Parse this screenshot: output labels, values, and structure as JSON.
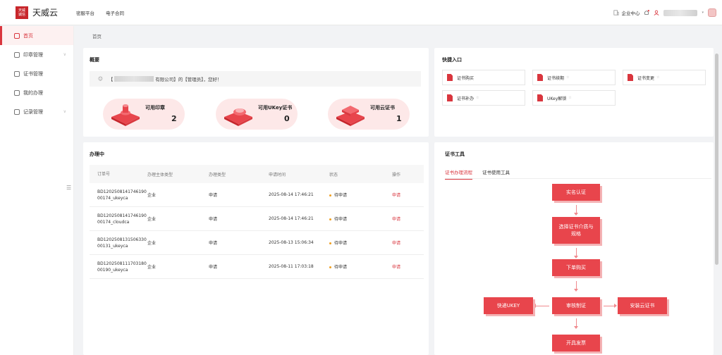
{
  "header": {
    "logo_text": "天威\n诚信",
    "brand": "天威云",
    "nav": [
      "密服平台",
      "电子合同"
    ],
    "enterprise_center": "企业中心"
  },
  "sidebar": {
    "items": [
      {
        "label": "首页",
        "icon": "home-icon",
        "active": true
      },
      {
        "label": "印章管理",
        "icon": "seal-icon",
        "has_children": true
      },
      {
        "label": "证书管理",
        "icon": "certificate-icon"
      },
      {
        "label": "我的办理",
        "icon": "task-icon"
      },
      {
        "label": "记录管理",
        "icon": "record-icon",
        "has_children": true
      }
    ]
  },
  "breadcrumb": "首页",
  "overview": {
    "title": "概要",
    "greeting_prefix": "【",
    "greeting_company_suffix": "有限公司】的【管理员】，您好！",
    "stats": [
      {
        "label": "可用印章",
        "value": "2"
      },
      {
        "label": "可用UKey证书",
        "value": "0"
      },
      {
        "label": "可用云证书",
        "value": "1"
      }
    ]
  },
  "quick_entry": {
    "title": "快捷入口",
    "items": [
      {
        "label": "证书购买",
        "starred": false
      },
      {
        "label": "证书续期",
        "starred": true
      },
      {
        "label": "证书变更",
        "starred": true
      },
      {
        "label": "证书补办",
        "starred": true
      },
      {
        "label": "UKey解锁",
        "starred": true
      }
    ],
    "star_glyph": "☆"
  },
  "processing": {
    "title": "办理中",
    "columns": [
      "订单号",
      "办理主体类型",
      "办理类型",
      "申请时间",
      "状态",
      "操作"
    ],
    "rows": [
      {
        "order_no_1": "BD1202508141746190",
        "order_no_2": "00174_ukeyca",
        "subject": "企业",
        "type": "申请",
        "time": "2025-08-14 17:46:21",
        "status": "待申请",
        "action": "申请"
      },
      {
        "order_no_1": "BD1202508141746190",
        "order_no_2": "00174_cloudca",
        "subject": "企业",
        "type": "申请",
        "time": "2025-08-14 17:46:21",
        "status": "待申请",
        "action": "申请"
      },
      {
        "order_no_1": "BD1202508131506330",
        "order_no_2": "00131_ukeyca",
        "subject": "企业",
        "type": "申请",
        "time": "2025-08-13 15:06:34",
        "status": "待申请",
        "action": "申请"
      },
      {
        "order_no_1": "BD1202508111703180",
        "order_no_2": "00190_ukeyca",
        "subject": "企业",
        "type": "申请",
        "time": "2025-08-11 17:03:18",
        "status": "待申请",
        "action": "申请"
      }
    ]
  },
  "cert_tools": {
    "title": "证书工具",
    "tabs": [
      "证书办理流程",
      "证书使用工具"
    ],
    "flow": {
      "step1": "实名认证",
      "step2": "选择证书介质与规格",
      "step3": "下单购买",
      "step4": "审核制证",
      "left": "快递UKEY",
      "right": "安装云证书",
      "step5": "开具发票"
    }
  },
  "colors": {
    "accent": "#d9363e",
    "flow_box": "#e8454c",
    "pending_dot": "#f0a020"
  }
}
